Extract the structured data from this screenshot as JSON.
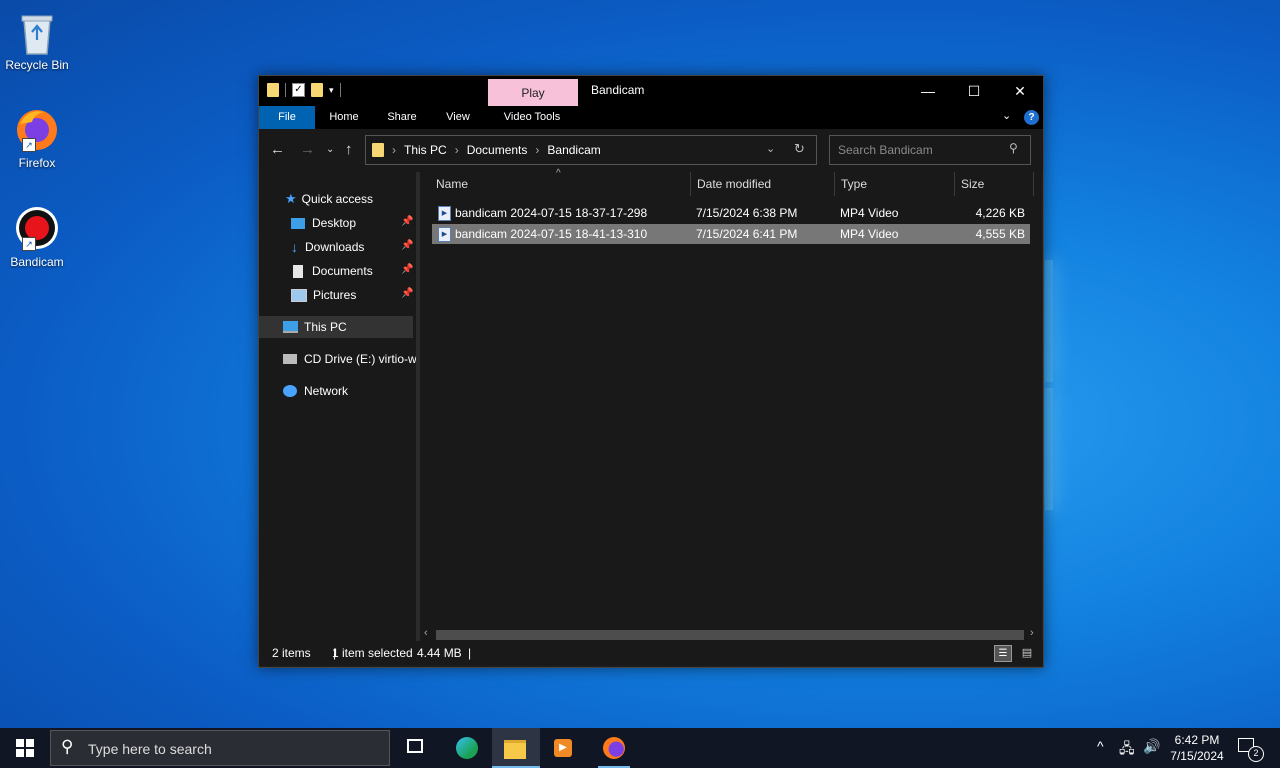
{
  "desktop": {
    "icons": [
      {
        "label": "Recycle Bin"
      },
      {
        "label": "Firefox"
      },
      {
        "label": "Bandicam"
      }
    ]
  },
  "window": {
    "title": "Bandicam",
    "context_tab": "Play",
    "ribbon_tabs": [
      "File",
      "Home",
      "Share",
      "View",
      "Video Tools"
    ],
    "breadcrumbs": [
      "This PC",
      "Documents",
      "Bandicam"
    ],
    "search_placeholder": "Search Bandicam",
    "help_label": "?"
  },
  "navpane": {
    "items": [
      {
        "label": "Quick access",
        "icon": "star-icon"
      },
      {
        "label": "Desktop",
        "icon": "desktop-icon"
      },
      {
        "label": "Downloads",
        "icon": "download-arrow-icon"
      },
      {
        "label": "Documents",
        "icon": "document-icon"
      },
      {
        "label": "Pictures",
        "icon": "pictures-icon"
      },
      {
        "label": "This PC",
        "icon": "computer-icon"
      },
      {
        "label": "CD Drive (E:) virtio-w",
        "icon": "cd-drive-icon"
      },
      {
        "label": "Network",
        "icon": "network-icon"
      }
    ]
  },
  "files": {
    "columns": [
      "Name",
      "Date modified",
      "Type",
      "Size"
    ],
    "rows": [
      {
        "name": "bandicam 2024-07-15 18-37-17-298",
        "date": "7/15/2024 6:38 PM",
        "type": "MP4 Video",
        "size": "4,226 KB",
        "selected": false
      },
      {
        "name": "bandicam 2024-07-15 18-41-13-310",
        "date": "7/15/2024 6:41 PM",
        "type": "MP4 Video",
        "size": "4,555 KB",
        "selected": true
      }
    ]
  },
  "status": {
    "items_count": "2 items",
    "selection": "1 item selected",
    "selection_size": "4.44 MB"
  },
  "taskbar": {
    "search_placeholder": "Type here to search",
    "time": "6:42 PM",
    "date": "7/15/2024",
    "notification_count": "2"
  },
  "colors": {
    "accent": "#0063b1",
    "context_tab": "#f7c1d9",
    "selected_row": "#777777",
    "window_bg": "#191919"
  }
}
